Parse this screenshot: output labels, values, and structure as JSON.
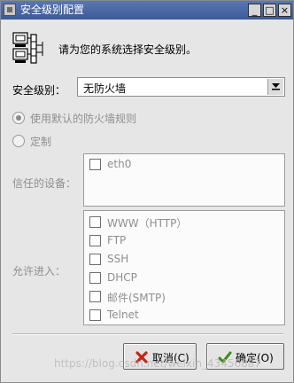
{
  "window": {
    "title": "安全级别配置",
    "buttons": {
      "minimize": "_",
      "maximize": "□",
      "close": "×"
    }
  },
  "header": {
    "icon": "firewall-computers-icon",
    "text": "请为您的系统选择安全级别。"
  },
  "security_level": {
    "label": "安全级别：",
    "selected": "无防火墙"
  },
  "firewall_mode": {
    "options": [
      {
        "label": "使用默认的防火墙规则",
        "selected": true
      },
      {
        "label": "定制",
        "selected": false
      }
    ]
  },
  "trusted_devices": {
    "label": "信任的设备：",
    "items": [
      {
        "label": "eth0",
        "checked": false
      }
    ]
  },
  "allow_incoming": {
    "label": "允许进入：",
    "items": [
      {
        "label": "WWW（HTTP）",
        "checked": false
      },
      {
        "label": "FTP",
        "checked": false
      },
      {
        "label": "SSH",
        "checked": false
      },
      {
        "label": "DHCP",
        "checked": false
      },
      {
        "label": "邮件(SMTP)",
        "checked": false
      },
      {
        "label": "Telnet",
        "checked": false
      }
    ]
  },
  "actions": {
    "cancel_label": "取消(C)",
    "ok_label": "确定(O)"
  },
  "watermark": "https://blog.csdn.net/weixin_43456887",
  "colors": {
    "titlebar": "#3b5a97",
    "cancel_icon": "#c0281c",
    "ok_icon": "#3c8a1c"
  }
}
